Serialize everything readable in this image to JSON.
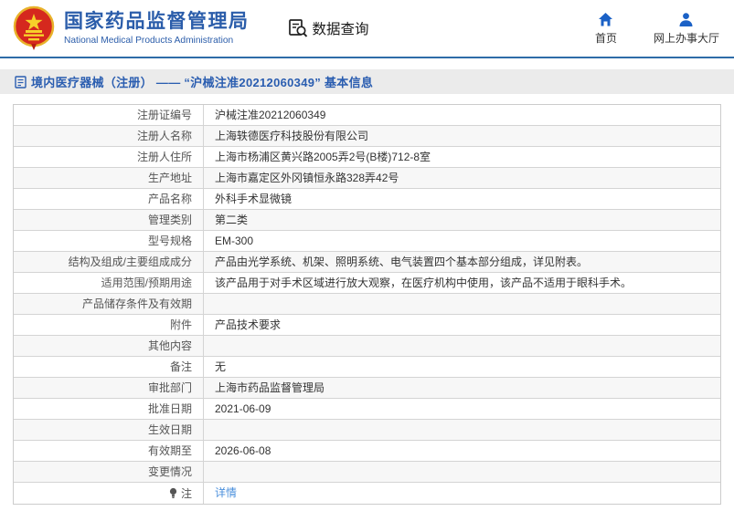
{
  "header": {
    "site_title": "国家药品监督管理局",
    "site_subtitle": "National Medical Products Administration",
    "query_label": "数据查询",
    "nav": [
      {
        "label": "首页",
        "icon": "home-icon"
      },
      {
        "label": "网上办事大厅",
        "icon": "user-icon"
      }
    ]
  },
  "breadcrumb": {
    "title": "境内医疗器械（注册） —— “沪械注准20212060349” 基本信息"
  },
  "table": {
    "rows": [
      {
        "label": "注册证编号",
        "value": "沪械注准20212060349"
      },
      {
        "label": "注册人名称",
        "value": "上海轶德医疗科技股份有限公司"
      },
      {
        "label": "注册人住所",
        "value": "上海市杨浦区黄兴路2005弄2号(B楼)712-8室"
      },
      {
        "label": "生产地址",
        "value": "上海市嘉定区外冈镇恒永路328弄42号"
      },
      {
        "label": "产品名称",
        "value": "外科手术显微镜"
      },
      {
        "label": "管理类别",
        "value": "第二类"
      },
      {
        "label": "型号规格",
        "value": "EM-300"
      },
      {
        "label": "结构及组成/主要组成成分",
        "value": "产品由光学系统、机架、照明系统、电气装置四个基本部分组成，详见附表。"
      },
      {
        "label": "适用范围/预期用途",
        "value": "该产品用于对手术区域进行放大观察，在医疗机构中使用，该产品不适用于眼科手术。"
      },
      {
        "label": "产品储存条件及有效期",
        "value": ""
      },
      {
        "label": "附件",
        "value": "产品技术要求"
      },
      {
        "label": "其他内容",
        "value": ""
      },
      {
        "label": "备注",
        "value": "无"
      },
      {
        "label": "审批部门",
        "value": "上海市药品监督管理局"
      },
      {
        "label": "批准日期",
        "value": "2021-06-09"
      },
      {
        "label": "生效日期",
        "value": ""
      },
      {
        "label": "有效期至",
        "value": "2026-06-08"
      },
      {
        "label": "变更情况",
        "value": ""
      },
      {
        "label": "注",
        "value": "详情",
        "value_is_link": true,
        "label_icon": "bulb-icon"
      }
    ]
  },
  "colors": {
    "brand_blue": "#2b5daa",
    "separator_blue": "#2e6ca8",
    "icon_blue": "#1b61c6",
    "link_blue": "#4a8fdc",
    "titlebar_gray": "#ebebeb"
  }
}
